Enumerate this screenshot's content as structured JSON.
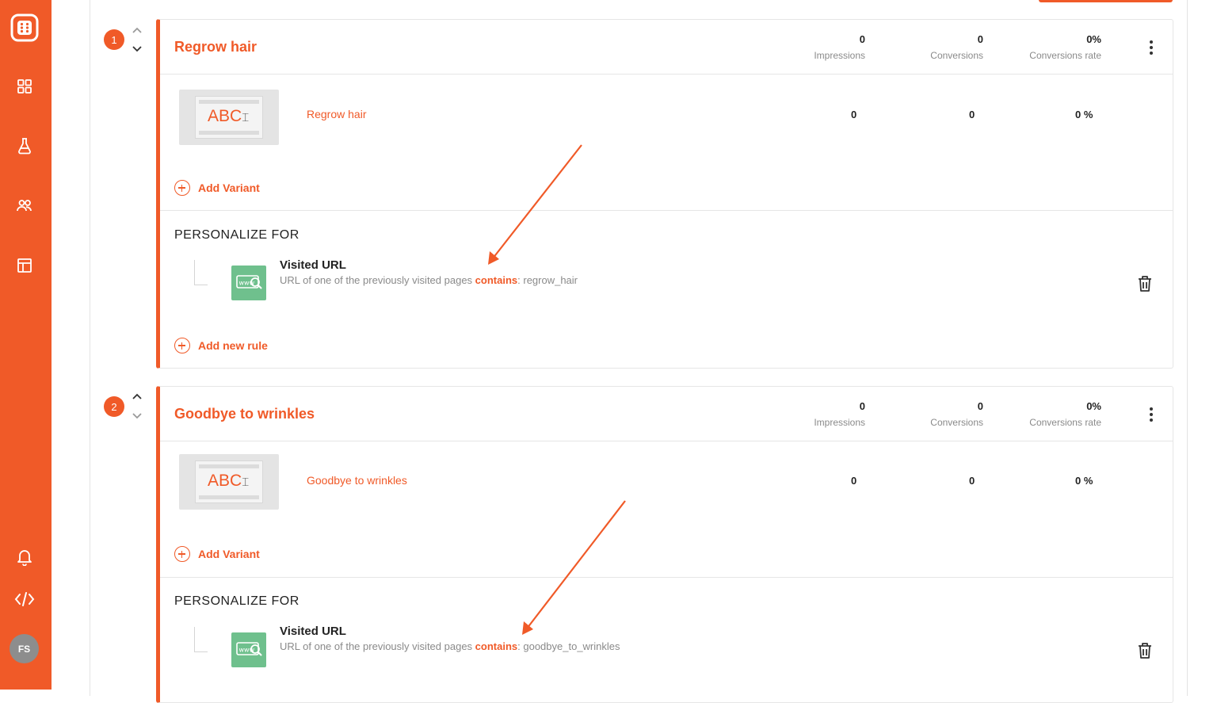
{
  "sidebar": {
    "brand_color": "#f05a28",
    "icons": [
      "app-logo-icon",
      "dashboard-icon",
      "experiments-flask-icon",
      "audience-users-icon",
      "layout-icon",
      "bell-icon",
      "code-icon"
    ],
    "avatar_initials": "FS"
  },
  "stats_labels": {
    "impressions": "Impressions",
    "conversions": "Conversions",
    "conversions_rate": "Conversions rate"
  },
  "links": {
    "add_variant": "Add Variant",
    "add_new_rule": "Add new rule",
    "personalize_for": "PERSONALIZE FOR"
  },
  "experiences": [
    {
      "index": "1",
      "title": "Regrow hair",
      "impressions": "0",
      "conversions": "0",
      "conversions_rate": "0%",
      "variant": {
        "thumb_text": "ABC",
        "name": "Regrow hair",
        "impressions": "0",
        "conversions": "0",
        "rate": "0 %"
      },
      "rule": {
        "title": "Visited URL",
        "desc_prefix": "URL of one of the previously visited pages ",
        "operator": "contains",
        "value": ": regrow_hair"
      }
    },
    {
      "index": "2",
      "title": "Goodbye to wrinkles",
      "impressions": "0",
      "conversions": "0",
      "conversions_rate": "0%",
      "variant": {
        "thumb_text": "ABC",
        "name": "Goodbye to wrinkles",
        "impressions": "0",
        "conversions": "0",
        "rate": "0 %"
      },
      "rule": {
        "title": "Visited URL",
        "desc_prefix": "URL of one of the previously visited pages ",
        "operator": "contains",
        "value": ": goodbye_to_wrinkles"
      }
    }
  ]
}
